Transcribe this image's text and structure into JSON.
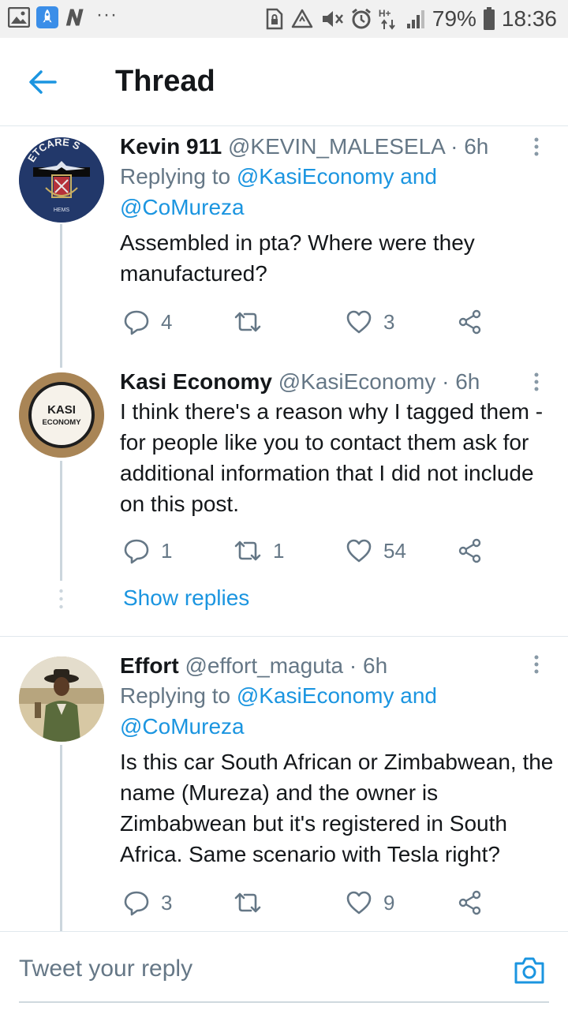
{
  "status_bar": {
    "battery_percent": "79%",
    "time": "18:36",
    "network": "H+",
    "left_icons": [
      "gallery-icon",
      "rocket-icon",
      "n-app-icon",
      "more-dots-icon"
    ],
    "right_icons": [
      "sim-lock-icon",
      "recycle-icon",
      "mute-icon",
      "alarm-icon",
      "network-h-plus-icon",
      "signal-icon",
      "battery-icon"
    ]
  },
  "header": {
    "title": "Thread",
    "back_icon": "arrow-left-icon"
  },
  "tweets": [
    {
      "name": "Kevin 911",
      "handle": "@KEVIN_MALESELA",
      "time": "· 6h",
      "replying_label": "Replying to",
      "reply_mentions": "@KasiEconomy and @CoMureza",
      "text": "Assembled in pta? Where were they manufactured?",
      "reply_count": "4",
      "retweet_count": "",
      "like_count": "3",
      "avatar_text": "ETCARE S",
      "avatar_small": "HEMS"
    },
    {
      "name": "Kasi Economy",
      "handle": "@KasiEconomy",
      "time": "· 6h",
      "text": "I think there's a reason why I tagged them - for people like you to contact them ask for additional information that I did not include on this post.",
      "reply_count": "1",
      "retweet_count": "1",
      "like_count": "54",
      "avatar_line1": "KASI",
      "avatar_line2": "ECONOMY"
    },
    {
      "name": "Effort",
      "handle": "@effort_maguta",
      "time": "· 6h",
      "replying_label": "Replying to",
      "reply_mentions": "@KasiEconomy and @CoMureza",
      "text": "Is this car South African or Zimbabwean, the name (Mureza) and the owner is Zimbabwean but it's registered in South Africa. Same scenario with Tesla right?",
      "reply_count": "3",
      "retweet_count": "",
      "like_count": "9"
    }
  ],
  "show_replies": "Show replies",
  "composer": {
    "placeholder": "Tweet your reply",
    "camera_icon": "camera-icon"
  },
  "colors": {
    "accent": "#1b95e0",
    "muted": "#657786",
    "text": "#14171a",
    "line": "#ccd6dd"
  }
}
